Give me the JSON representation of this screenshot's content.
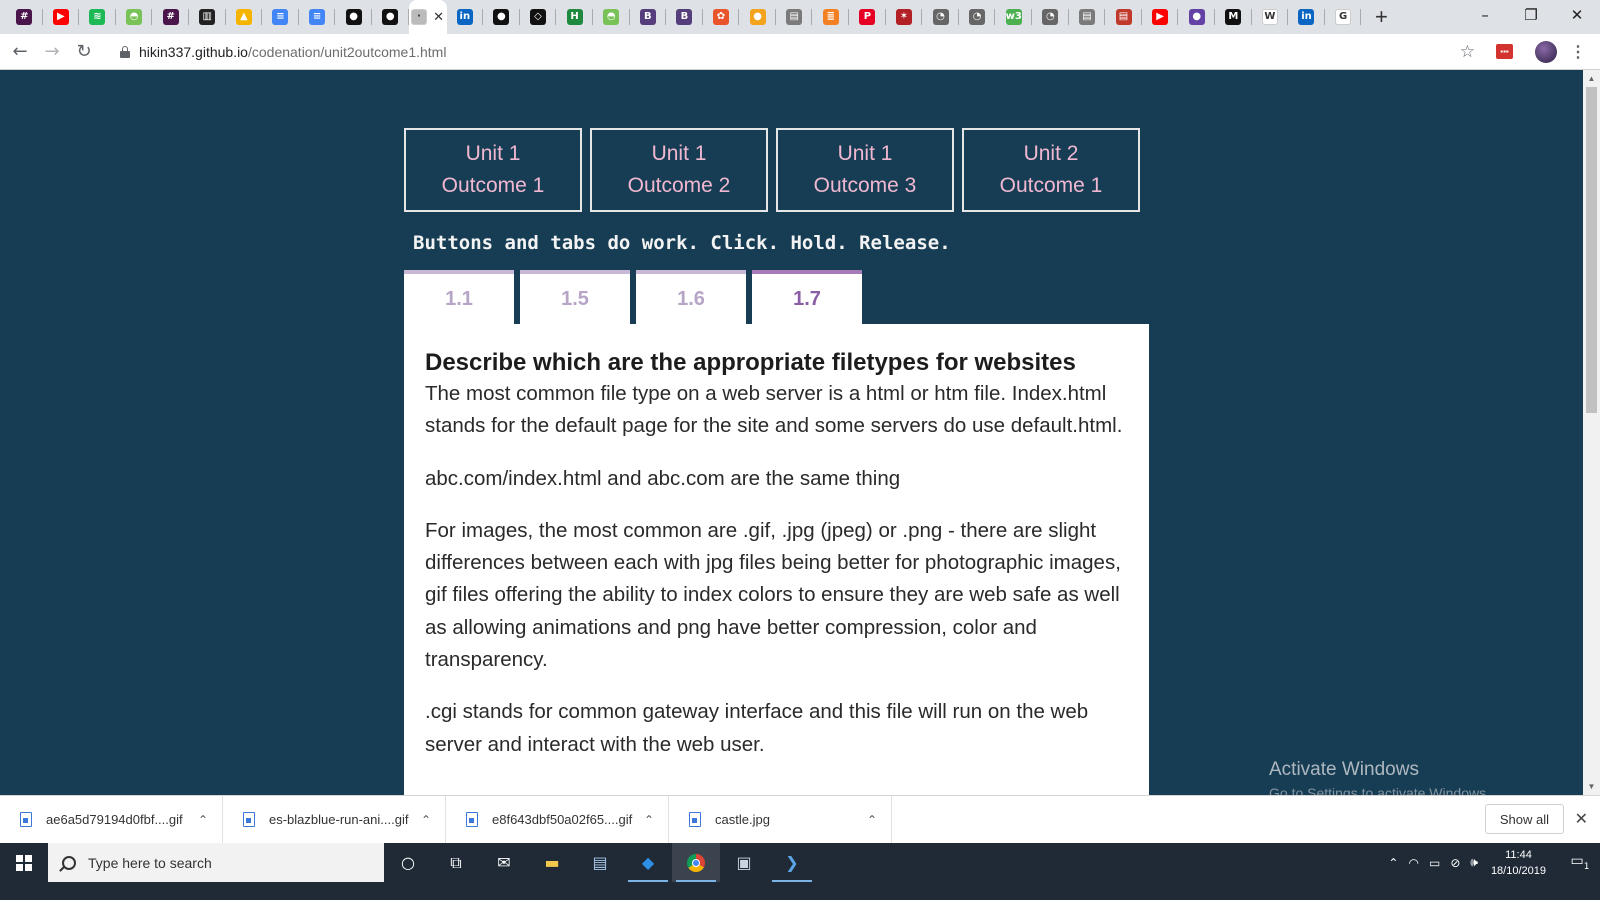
{
  "browser": {
    "tabs": [
      {
        "icon": "slack-icon",
        "color": "#4a154b",
        "glyph": "#"
      },
      {
        "icon": "youtube-icon",
        "color": "#ff0000",
        "glyph": "▶"
      },
      {
        "icon": "spotify-icon",
        "color": "#1db954",
        "glyph": "≋"
      },
      {
        "icon": "android-icon",
        "color": "#78c257",
        "glyph": "◓"
      },
      {
        "icon": "slack-icon",
        "color": "#4a154b",
        "glyph": "#"
      },
      {
        "icon": "trello-icon",
        "color": "#222222",
        "glyph": "▥"
      },
      {
        "icon": "drive-icon",
        "color": "#f4b400",
        "glyph": "▲"
      },
      {
        "icon": "docs-icon",
        "color": "#4285f4",
        "glyph": "≡"
      },
      {
        "icon": "docs-icon",
        "color": "#4285f4",
        "glyph": "≡"
      },
      {
        "icon": "github-icon",
        "color": "#111111",
        "glyph": "●"
      },
      {
        "icon": "github-icon",
        "color": "#111111",
        "glyph": "●"
      },
      {
        "icon": "current-tab-icon",
        "color": "#bbbbbb",
        "glyph": "⋅",
        "active": true
      },
      {
        "icon": "linkedin-icon",
        "color": "#0a66c2",
        "glyph": "in"
      },
      {
        "icon": "github-icon",
        "color": "#111111",
        "glyph": "●"
      },
      {
        "icon": "codepen-icon",
        "color": "#111111",
        "glyph": "◇"
      },
      {
        "icon": "hackerrank-icon",
        "color": "#1f8a3e",
        "glyph": "H"
      },
      {
        "icon": "android-icon",
        "color": "#78c257",
        "glyph": "◓"
      },
      {
        "icon": "bootstrap-icon",
        "color": "#563d7c",
        "glyph": "B"
      },
      {
        "icon": "bootstrap-icon",
        "color": "#563d7c",
        "glyph": "B"
      },
      {
        "icon": "candy-icon",
        "color": "#e9542b",
        "glyph": "✿"
      },
      {
        "icon": "fruit-icon",
        "color": "#f4a41c",
        "glyph": "●"
      },
      {
        "icon": "page-icon",
        "color": "#7a7a7a",
        "glyph": "▤"
      },
      {
        "icon": "stackoverflow-icon",
        "color": "#f48024",
        "glyph": "≣"
      },
      {
        "icon": "pinterest-icon",
        "color": "#e60023",
        "glyph": "P"
      },
      {
        "icon": "game-icon",
        "color": "#b21f24",
        "glyph": "✶"
      },
      {
        "icon": "globe-icon",
        "color": "#666666",
        "glyph": "◔"
      },
      {
        "icon": "globe-icon",
        "color": "#666666",
        "glyph": "◔"
      },
      {
        "icon": "w3schools-icon",
        "color": "#4caf50",
        "glyph": "w3"
      },
      {
        "icon": "globe-icon",
        "color": "#666666",
        "glyph": "◔"
      },
      {
        "icon": "page-icon",
        "color": "#7a7a7a",
        "glyph": "▤"
      },
      {
        "icon": "page-icon",
        "color": "#c0392b",
        "glyph": "▤"
      },
      {
        "icon": "youtube-icon",
        "color": "#ff0000",
        "glyph": "▶"
      },
      {
        "icon": "twitch-icon",
        "color": "#6441a5",
        "glyph": "●"
      },
      {
        "icon": "medium-icon",
        "color": "#111111",
        "glyph": "M"
      },
      {
        "icon": "wikipedia-icon",
        "color": "#ffffff",
        "glyph": "W"
      },
      {
        "icon": "linkedin-icon",
        "color": "#0a66c2",
        "glyph": "in"
      },
      {
        "icon": "google-icon",
        "color": "#ffffff",
        "glyph": "G"
      }
    ],
    "url_host": "hikin337.github.io",
    "url_path": "/codenation/unit2outcome1.html"
  },
  "page": {
    "unit_buttons": [
      {
        "line1": "Unit 1",
        "line2": "Outcome 1"
      },
      {
        "line1": "Unit 1",
        "line2": "Outcome 2"
      },
      {
        "line1": "Unit 1",
        "line2": "Outcome 3"
      },
      {
        "line1": "Unit 2",
        "line2": "Outcome 1"
      }
    ],
    "note": "Buttons and tabs do work. Click. Hold. Release.",
    "tabs": [
      "1.1",
      "1.5",
      "1.6",
      "1.7"
    ],
    "selected_tab": "1.7",
    "heading": "Describe which are the appropriate filetypes for websites",
    "paragraphs": [
      "The most common file type on a web server is a html or htm file. Index.html stands for the default page for the site and some servers do use default.html.",
      "abc.com/index.html and abc.com are the same thing",
      "For images, the most common are .gif, .jpg (jpeg) or .png - there are slight differences between each with jpg files being better for photographic images, gif files offering the ability to index colors to ensure they are web safe as well as allowing animations and png have better compression, color and transparency.",
      ".cgi stands for common gateway interface and this file will run on the web server and interact with the web user."
    ]
  },
  "watermark": {
    "title": "Activate Windows",
    "subtitle": "Go to Settings to activate Windows."
  },
  "downloads": {
    "items": [
      "ae6a5d79194d0fbf....gif",
      "es-blazblue-run-ani....gif",
      "e8f643dbf50a02f65....gif",
      "castle.jpg"
    ],
    "show_all": "Show all"
  },
  "taskbar": {
    "search_placeholder": "Type here to search",
    "time": "11:44",
    "date": "18/10/2019",
    "notification_count": "1"
  }
}
